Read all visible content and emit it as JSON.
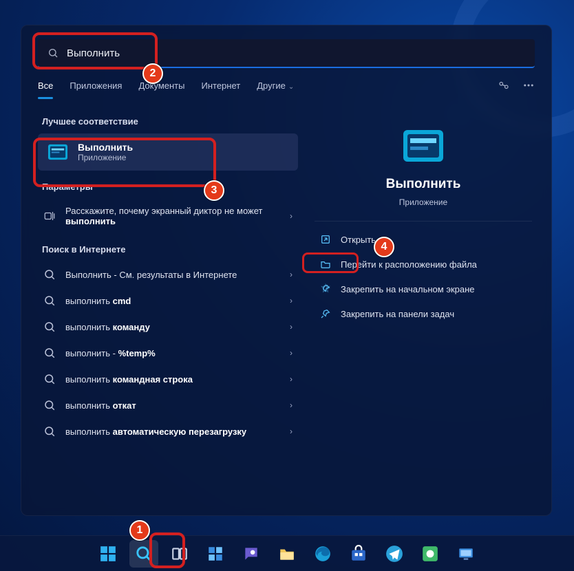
{
  "search": {
    "value": "Выполнить"
  },
  "tabs": {
    "all": "Все",
    "apps": "Приложения",
    "docs": "Документы",
    "web": "Интернет",
    "more": "Другие"
  },
  "sections": {
    "best": "Лучшее соответствие",
    "settings": "Параметры",
    "websearch": "Поиск в Интернете"
  },
  "best_match": {
    "title": "Выполнить",
    "subtitle": "Приложение"
  },
  "settings_row": {
    "text_pre": "Расскажите, почему экранный диктор не может ",
    "text_bold": "выполнить"
  },
  "web_rows": [
    {
      "pre": "Выполнить",
      "mid": " - См. результаты в Интернете",
      "bold": ""
    },
    {
      "pre": "выполнить ",
      "mid": "",
      "bold": "cmd"
    },
    {
      "pre": "выполнить ",
      "mid": "",
      "bold": "команду"
    },
    {
      "pre": "выполнить ",
      "mid": "- ",
      "bold": "%temp%"
    },
    {
      "pre": "выполнить ",
      "mid": "",
      "bold": "командная строка"
    },
    {
      "pre": "выполнить ",
      "mid": "",
      "bold": "откат"
    },
    {
      "pre": "выполнить ",
      "mid": "",
      "bold": "автоматическую перезагрузку"
    }
  ],
  "preview": {
    "title": "Выполнить",
    "subtitle": "Приложение",
    "actions": {
      "open": "Открыть",
      "location": "Перейти к расположению файла",
      "pin_start": "Закрепить на начальном экране",
      "pin_taskbar": "Закрепить на панели задач"
    }
  },
  "annotations": {
    "1": "1",
    "2": "2",
    "3": "3",
    "4": "4"
  }
}
